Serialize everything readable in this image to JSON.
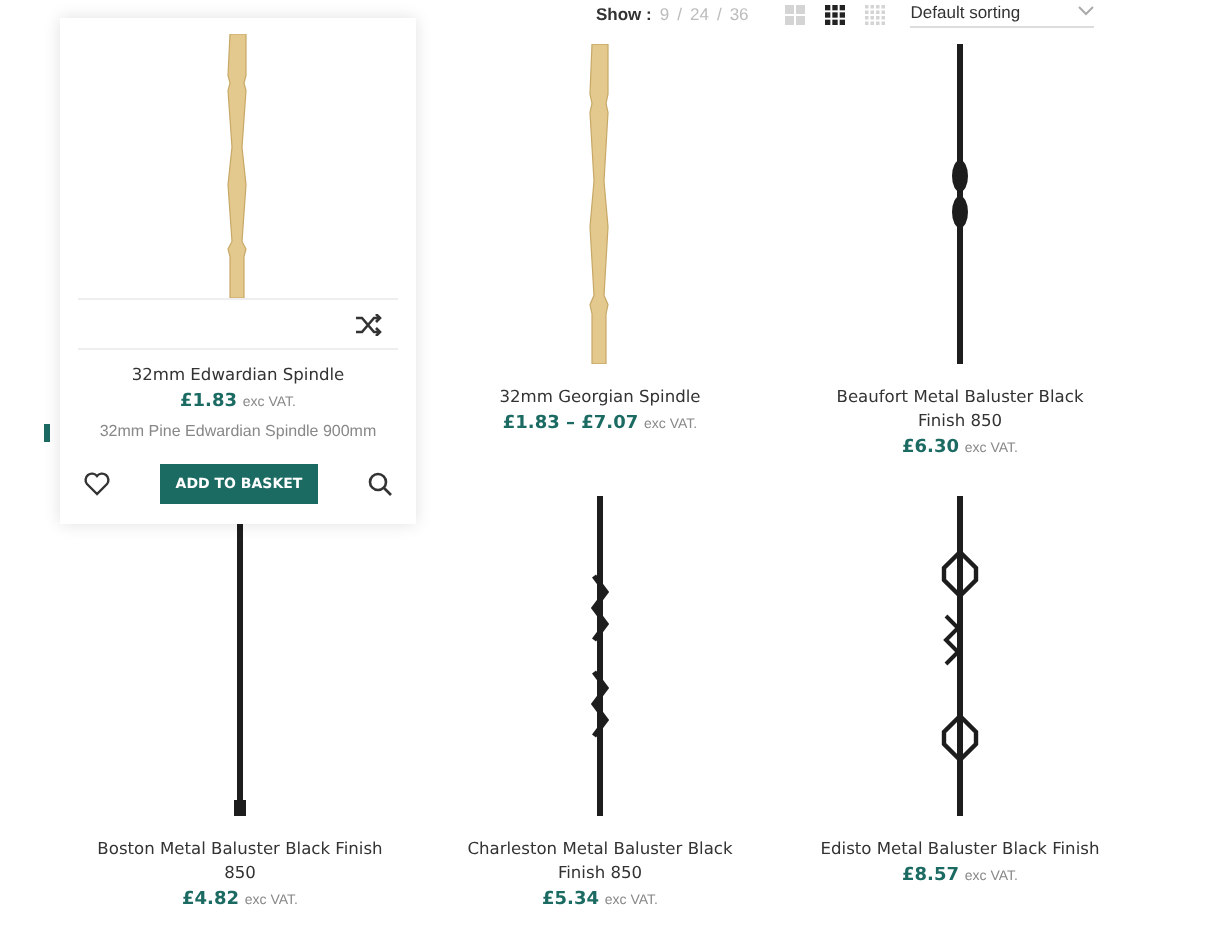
{
  "toolbar": {
    "show_label": "Show :",
    "page_sizes": [
      {
        "label": "9",
        "selected": false
      },
      {
        "separator": "/"
      },
      {
        "label": "24",
        "selected": false
      },
      {
        "separator": "/"
      },
      {
        "label": "36",
        "selected": false
      }
    ],
    "views": [
      {
        "kind": "grid-2",
        "selected": false
      },
      {
        "kind": "grid-3",
        "selected": true
      },
      {
        "kind": "grid-4",
        "selected": false
      }
    ],
    "sorting": "Default sorting"
  },
  "products": [
    {
      "name": "32mm Edwardian Spindle",
      "price": "£1.83",
      "tax_note": "exc VAT.",
      "kind": "wood-spindle",
      "hovered": true,
      "description": "32mm Pine Edwardian Spindle 900mm",
      "button": "ADD TO BASKET"
    },
    {
      "name": "32mm Georgian Spindle",
      "price": "£1.83 – £7.07",
      "tax_note": "exc VAT.",
      "kind": "wood-spindle",
      "hovered": false
    },
    {
      "name": "Beaufort Metal Baluster Black Finish 850",
      "price": "£6.30",
      "tax_note": "exc VAT.",
      "kind": "metal-knuckle",
      "hovered": false
    },
    {
      "name": "Boston Metal Baluster Black Finish 850",
      "price": "£4.82",
      "tax_note": "exc VAT.",
      "kind": "metal-plain",
      "hovered": false
    },
    {
      "name": "Charleston Metal Baluster Black Finish 850",
      "price": "£5.34",
      "tax_note": "exc VAT.",
      "kind": "metal-twist",
      "hovered": false
    },
    {
      "name": "Edisto Metal Baluster Black Finish",
      "price": "£8.57",
      "tax_note": "exc VAT.",
      "kind": "metal-rings",
      "hovered": false
    }
  ]
}
